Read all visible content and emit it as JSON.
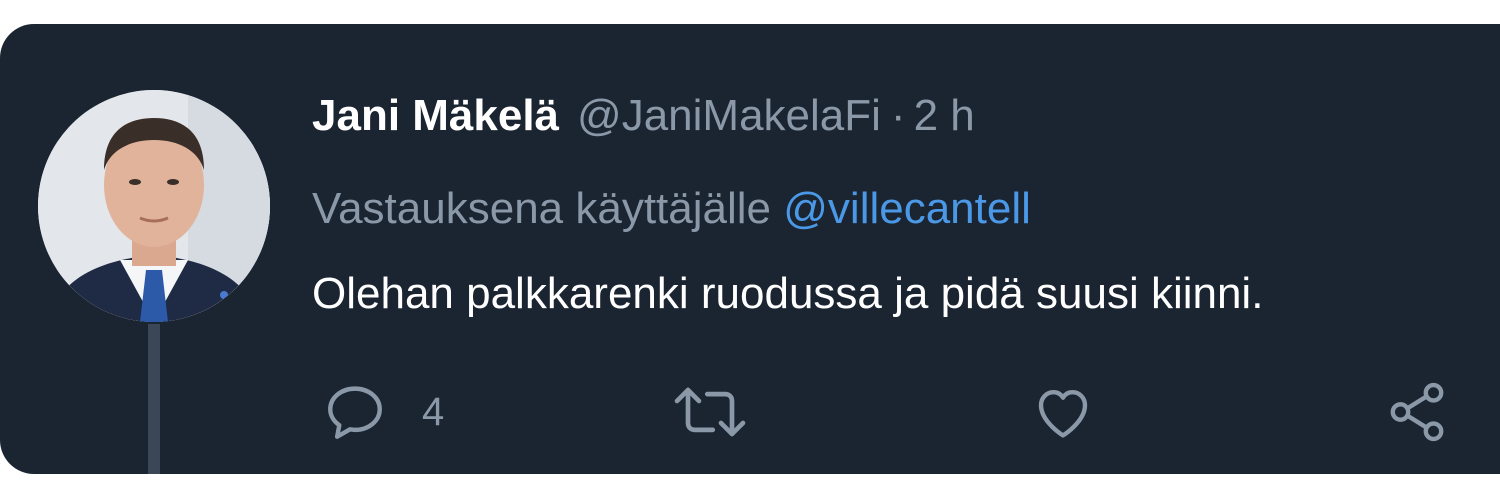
{
  "tweet": {
    "author": {
      "display_name": "Jani Mäkelä",
      "handle": "@JaniMakelaFi"
    },
    "separator": "·",
    "time": "2 h",
    "reply_prefix": "Vastauksena käyttäjälle",
    "reply_to": "@villecantell",
    "text": "Olehan palkkarenki ruodussa ja pidä suusi kiinni.",
    "actions": {
      "reply_icon": "reply-bubble-icon",
      "reply_count": "4",
      "retweet_icon": "retweet-icon",
      "like_icon": "heart-icon",
      "share_icon": "share-icon"
    }
  },
  "colors": {
    "background": "#1b2431",
    "text": "#ffffff",
    "muted": "#8a98a8",
    "link": "#4a98e6",
    "thread_line": "#3b4756"
  }
}
